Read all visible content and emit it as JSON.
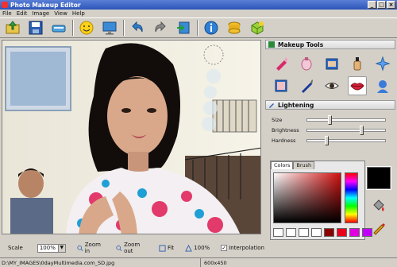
{
  "window": {
    "title": "Photo Makeup Editor",
    "buttons": [
      "_",
      "□",
      "×"
    ]
  },
  "menu": [
    "File",
    "Edit",
    "Image",
    "View",
    "Help"
  ],
  "toolbar": {
    "buttons": [
      "open-icon",
      "save-icon",
      "scanner-icon",
      "smile-icon",
      "monitor-icon",
      "undo-icon",
      "redo-icon",
      "export-icon",
      "info-icon",
      "coins-icon",
      "box-icon"
    ]
  },
  "panel": {
    "makeup_title": "Makeup Tools",
    "lightening_title": "Lightening",
    "sliders": [
      {
        "label": "Size",
        "value": 0.3
      },
      {
        "label": "Brightness",
        "value": 0.7
      },
      {
        "label": "Hardness",
        "value": 0.25
      }
    ],
    "color_tabs": [
      "Colors",
      "Brush"
    ],
    "swatches": [
      "#ffffff",
      "#ffffff",
      "#ffffff",
      "#ffffff",
      "#8b0000",
      "#e8001c",
      "#e000e0",
      "#c000ff"
    ],
    "foreground_color": "#000000"
  },
  "bottom": {
    "scale_label": "Scale",
    "scale_value": "100%",
    "zoom_in": "Zoom in",
    "zoom_out": "Zoom out",
    "fit": "Fit",
    "hundred": "100%",
    "interpolation": "Interpolation",
    "interpolation_checked": true
  },
  "status": {
    "path": "D:\\MY_IMAGES\\0dayMultimedia.com_SD.jpg",
    "size": "600x450"
  }
}
